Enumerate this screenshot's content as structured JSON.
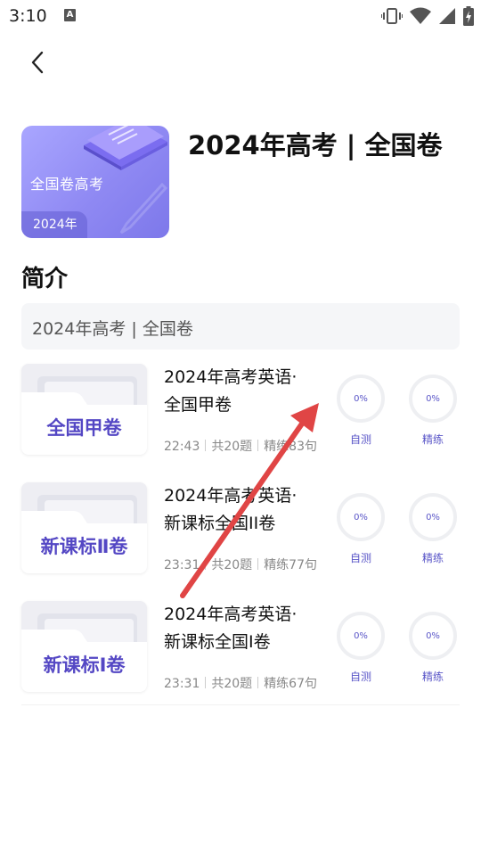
{
  "status_bar": {
    "time": "3:10",
    "a_badge": "A"
  },
  "book": {
    "cover_title": "全国卷高考",
    "cover_year": "2024年",
    "title": "2024年高考 | 全国卷"
  },
  "intro": {
    "heading": "简介",
    "text": "2024年高考 | 全国卷"
  },
  "exams": [
    {
      "thumb": "全国甲卷",
      "line1": "2024年高考英语·",
      "line2": "全国甲卷",
      "time": "22:43",
      "count": "共20题",
      "practice": "精练83句",
      "self_pct": "0%",
      "self_label": "自测",
      "refine_pct": "0%",
      "refine_label": "精练"
    },
    {
      "thumb": "新课标Ⅱ卷",
      "line1": "2024年高考英语·",
      "line2": "新课标全国II卷",
      "time": "23:31",
      "count": "共20题",
      "practice": "精练77句",
      "self_pct": "0%",
      "self_label": "自测",
      "refine_pct": "0%",
      "refine_label": "精练"
    },
    {
      "thumb": "新课标Ⅰ卷",
      "line1": "2024年高考英语·",
      "line2": "新课标全国I卷",
      "time": "23:31",
      "count": "共20题",
      "practice": "精练67句",
      "self_pct": "0%",
      "self_label": "自测",
      "refine_pct": "0%",
      "refine_label": "精练"
    }
  ],
  "colors": {
    "accent": "#5b57c8",
    "cover_start": "#a9a6ff",
    "cover_end": "#7d78ea",
    "arrow": "#e04545"
  }
}
